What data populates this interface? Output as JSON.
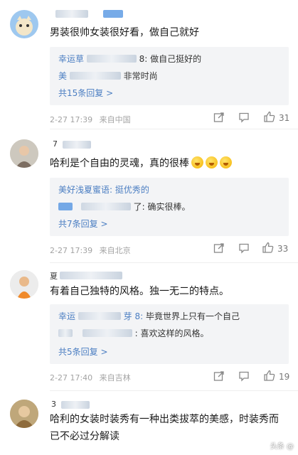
{
  "comments": [
    {
      "text": "男装很帅女装很好看，做自己就好",
      "replies": [
        "8: 做自己挺好的",
        "非常时尚"
      ],
      "reply_names": [
        "幸运草",
        "美"
      ],
      "more": "共15条回复 >",
      "time": "2-27 17:39",
      "location": "来自中国",
      "likes": "31"
    },
    {
      "text": "哈利是个自由的灵魂，真的很棒",
      "replies": [
        "美好浅夏蜜语: 挺优秀的",
        "了: 确实很棒。"
      ],
      "more": "共7条回复 >",
      "time": "2-27 17:39",
      "location": "来自北京",
      "likes": "33"
    },
    {
      "text": "有着自己独特的风格。独一无二的特点。",
      "replies": [
        "毕竟世界上只有一个自己",
        ": 喜欢这样的风格。"
      ],
      "reply_names": [
        "幸运",
        "芽 8:"
      ],
      "more": "共5条回复 >",
      "time": "2-27 17:40",
      "location": "来自吉林",
      "likes": "19"
    },
    {
      "text": "哈利的女装时装秀有一种出类拔萃的美感，时装秀而已不必过分解读"
    }
  ],
  "icons": [
    "share-icon",
    "comment-icon",
    "like-icon"
  ],
  "watermark": "头条 @"
}
